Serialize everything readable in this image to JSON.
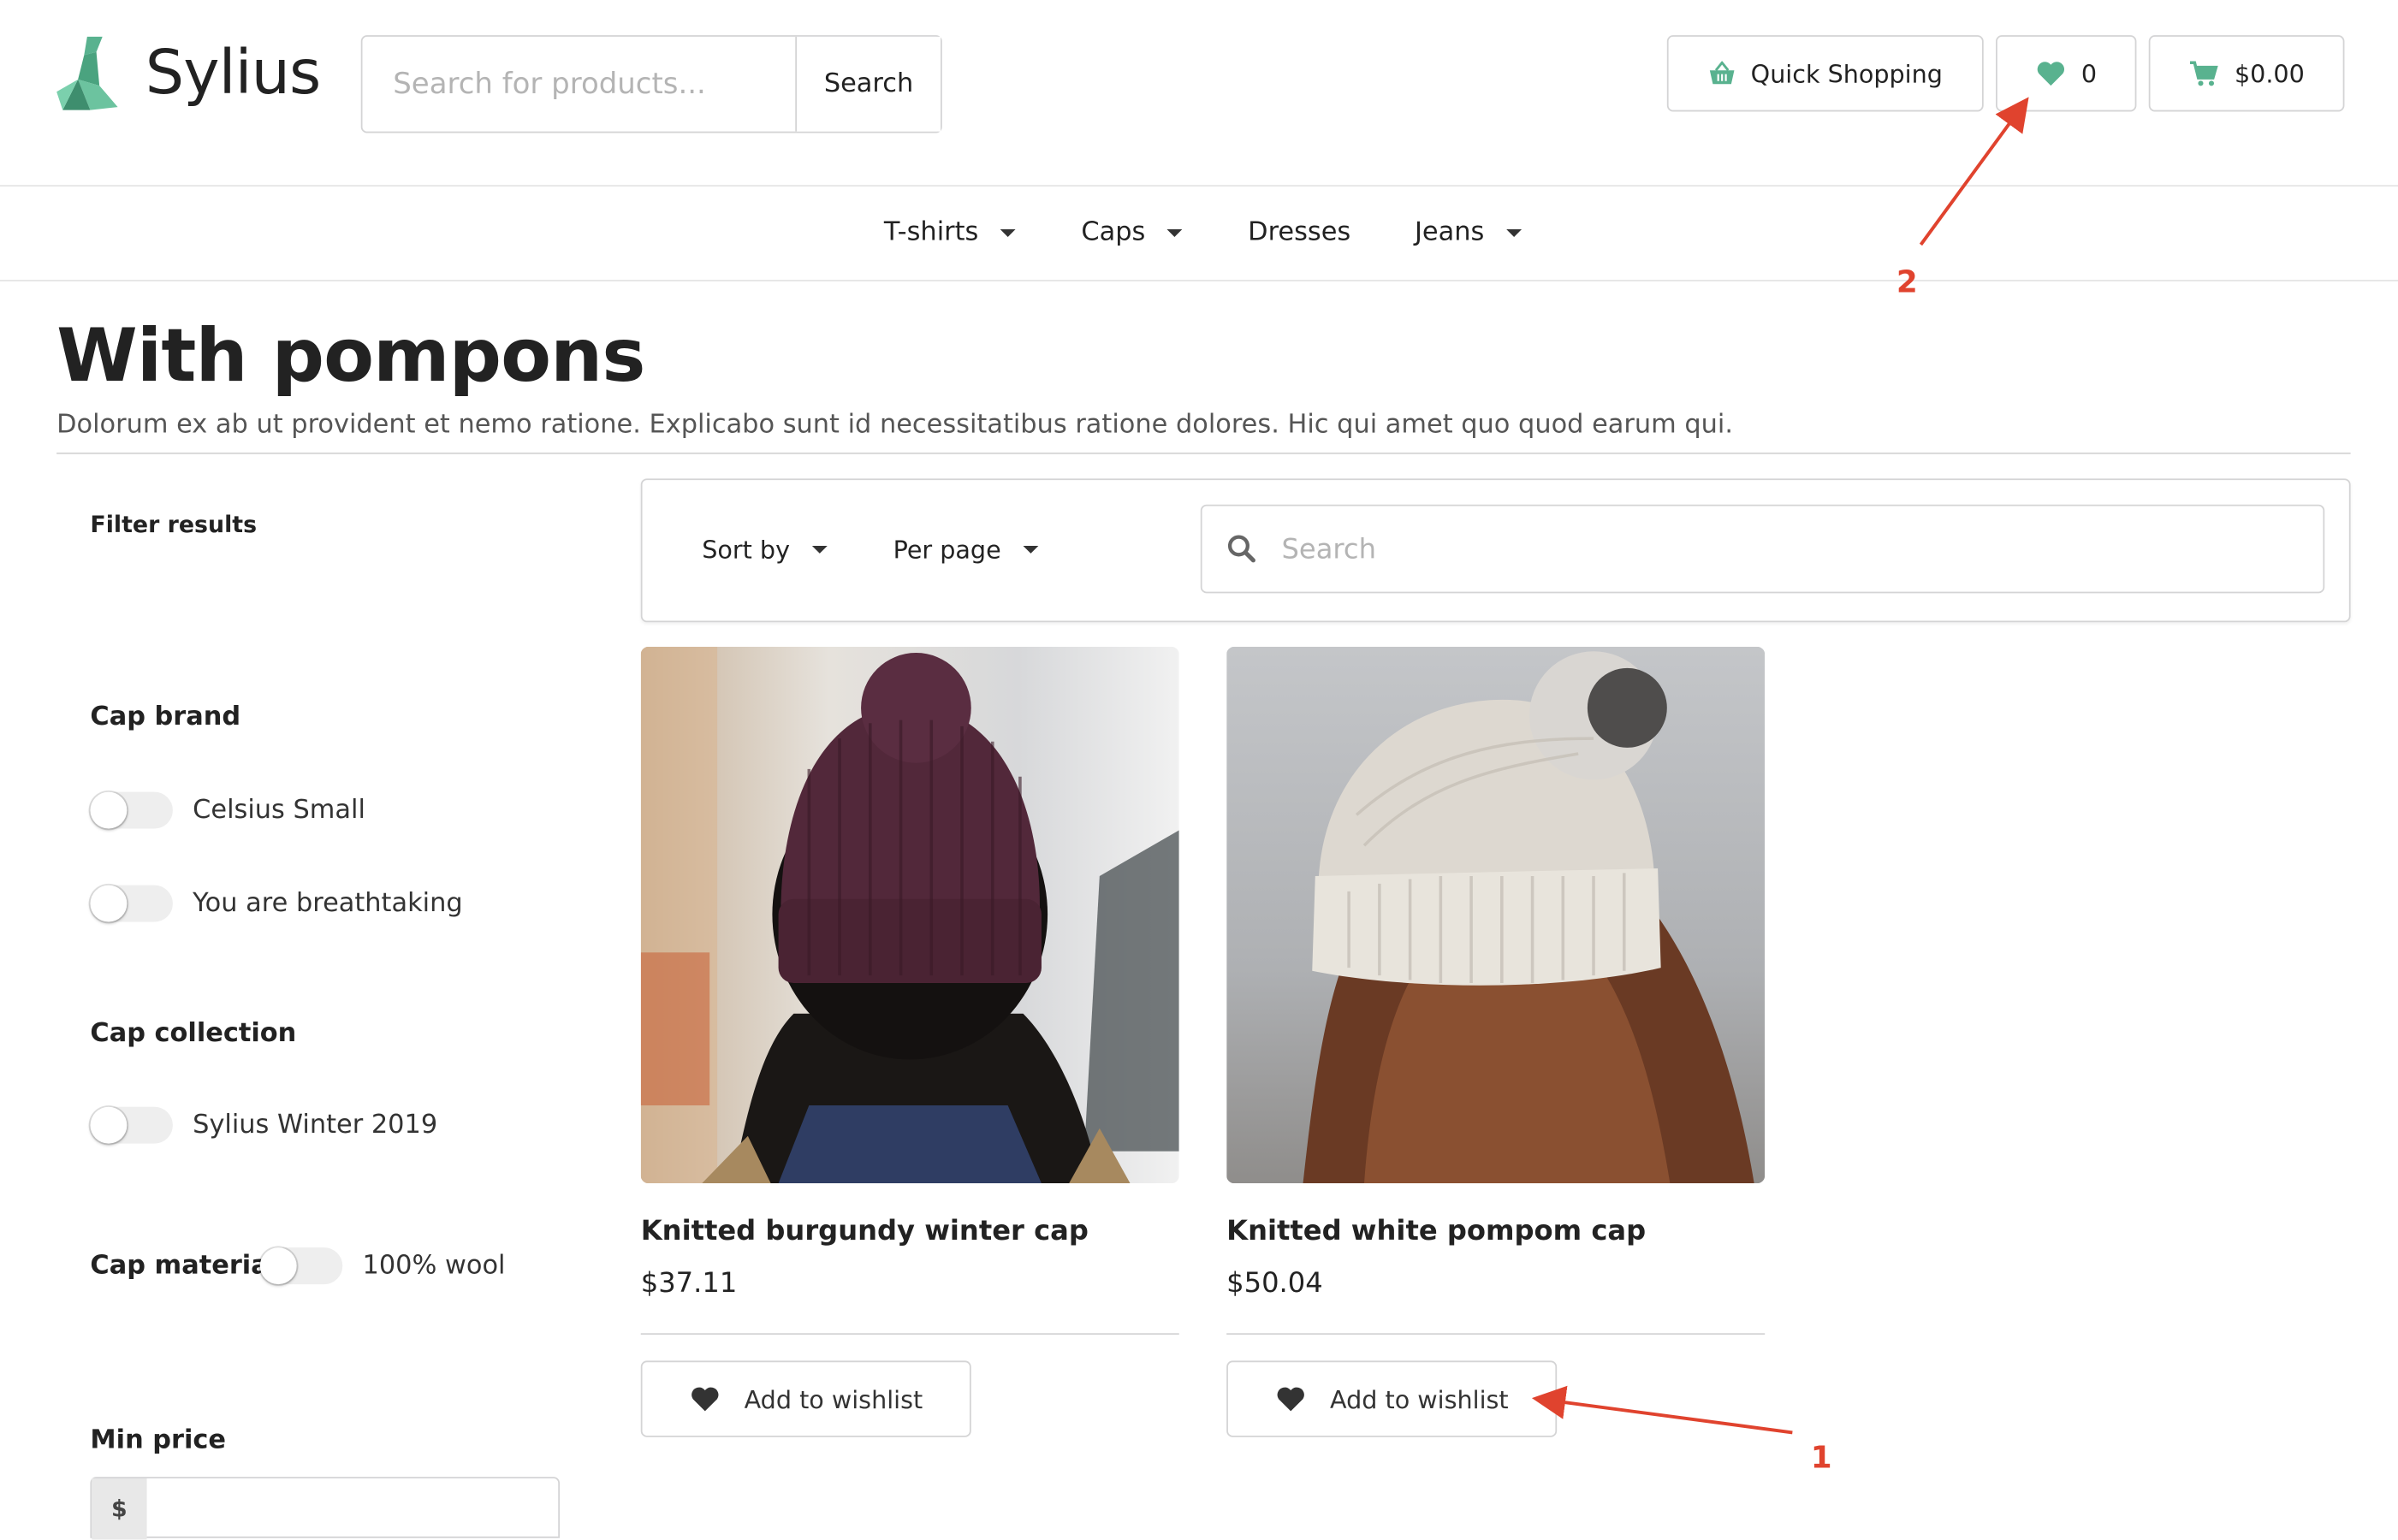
{
  "header": {
    "logo_text": "Sylius",
    "search_placeholder": "Search for products...",
    "search_button": "Search",
    "quick_shopping": "Quick Shopping",
    "wishlist_count": "0",
    "cart_total": "$0.00"
  },
  "nav": {
    "items": [
      {
        "label": "T-shirts",
        "dropdown": true
      },
      {
        "label": "Caps",
        "dropdown": true
      },
      {
        "label": "Dresses",
        "dropdown": false
      },
      {
        "label": "Jeans",
        "dropdown": true
      }
    ]
  },
  "page": {
    "title": "With pompons",
    "description": "Dolorum ex ab ut provident et nemo ratione. Explicabo sunt id necessitatibus ratione dolores. Hic qui amet quo quod earum qui."
  },
  "sidebar": {
    "filter_title": "Filter results",
    "groups": [
      {
        "title": "Cap brand",
        "options": [
          "Celsius Small",
          "You are breathtaking"
        ]
      },
      {
        "title": "Cap collection",
        "options": [
          "Sylius Winter 2019"
        ]
      },
      {
        "title": "Cap material",
        "options": [
          "100% wool"
        ]
      }
    ],
    "min_price_label": "Min price",
    "currency_symbol": "$"
  },
  "toolbar": {
    "sort_by": "Sort by",
    "per_page": "Per page",
    "search_placeholder": "Search"
  },
  "products": [
    {
      "name": "Knitted burgundy winter cap",
      "price": "$37.11",
      "wishlist_label": "Add to wishlist"
    },
    {
      "name": "Knitted white pompom cap",
      "price": "$50.04",
      "wishlist_label": "Add to wishlist"
    }
  ],
  "annotations": {
    "label_1": "1",
    "label_2": "2",
    "color": "#e0432e"
  },
  "colors": {
    "accent": "#59b28f",
    "text": "#222222",
    "border": "#d4d4d5"
  },
  "icons": [
    "swan-logo",
    "basket-icon",
    "heart-icon",
    "cart-icon",
    "search-icon",
    "caret-down-icon"
  ]
}
